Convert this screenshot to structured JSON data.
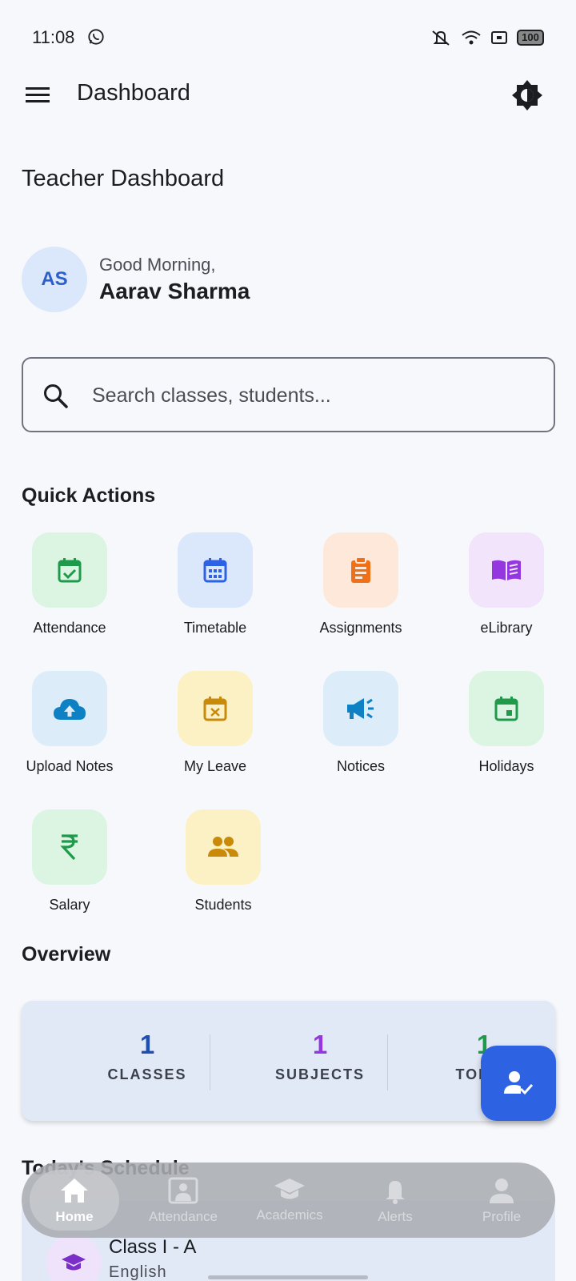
{
  "status_bar": {
    "time": "11:08",
    "battery": "100"
  },
  "app_bar": {
    "title": "Dashboard"
  },
  "page_heading": "Teacher Dashboard",
  "greeting": {
    "avatar_initials": "AS",
    "salutation": "Good Morning,",
    "name": "Aarav Sharma"
  },
  "search": {
    "placeholder": "Search classes, students..."
  },
  "quick_actions": {
    "title": "Quick Actions",
    "items": [
      {
        "label": "Attendance",
        "icon": "calendar-check-icon",
        "color": "#1e9a4a",
        "bg": "#dcf5e3"
      },
      {
        "label": "Timetable",
        "icon": "calendar-grid-icon",
        "color": "#2d63e3",
        "bg": "#dbe7fb"
      },
      {
        "label": "Assignments",
        "icon": "clipboard-icon",
        "color": "#f07018",
        "bg": "#fde8d9"
      },
      {
        "label": "eLibrary",
        "icon": "book-open-icon",
        "color": "#9437e0",
        "bg": "#f1e4fb"
      },
      {
        "label": "Upload Notes",
        "icon": "cloud-upload-icon",
        "color": "#0e80c4",
        "bg": "#dcecf9"
      },
      {
        "label": "My Leave",
        "icon": "calendar-x-icon",
        "color": "#c98a0a",
        "bg": "#fcf1c4"
      },
      {
        "label": "Notices",
        "icon": "megaphone-icon",
        "color": "#0e80c4",
        "bg": "#dcecf9"
      },
      {
        "label": "Holidays",
        "icon": "calendar-event-icon",
        "color": "#1e9a4a",
        "bg": "#dcf5e3"
      },
      {
        "label": "Salary",
        "icon": "rupee-icon",
        "color": "#1e9a4a",
        "bg": "#dcf5e3"
      },
      {
        "label": "Students",
        "icon": "people-icon",
        "color": "#c98a0a",
        "bg": "#fcf1c4"
      }
    ]
  },
  "overview": {
    "title": "Overview",
    "stats": [
      {
        "value": "1",
        "label": "CLASSES",
        "color": "#1f4fb5"
      },
      {
        "value": "1",
        "label": "SUBJECTS",
        "color": "#9437e0"
      },
      {
        "value": "1",
        "label": "TODAY",
        "color": "#1e9a4a"
      }
    ]
  },
  "schedule": {
    "title": "Today's Schedule",
    "items": [
      {
        "class": "Class I - A",
        "subject": "English"
      }
    ]
  },
  "bottom_nav": {
    "items": [
      {
        "label": "Home",
        "icon": "home-icon",
        "active": true
      },
      {
        "label": "Attendance",
        "icon": "attendance-icon",
        "active": false
      },
      {
        "label": "Academics",
        "icon": "graduation-cap-icon",
        "active": false
      },
      {
        "label": "Alerts",
        "icon": "bell-icon",
        "active": false
      },
      {
        "label": "Profile",
        "icon": "person-icon",
        "active": false
      }
    ]
  }
}
